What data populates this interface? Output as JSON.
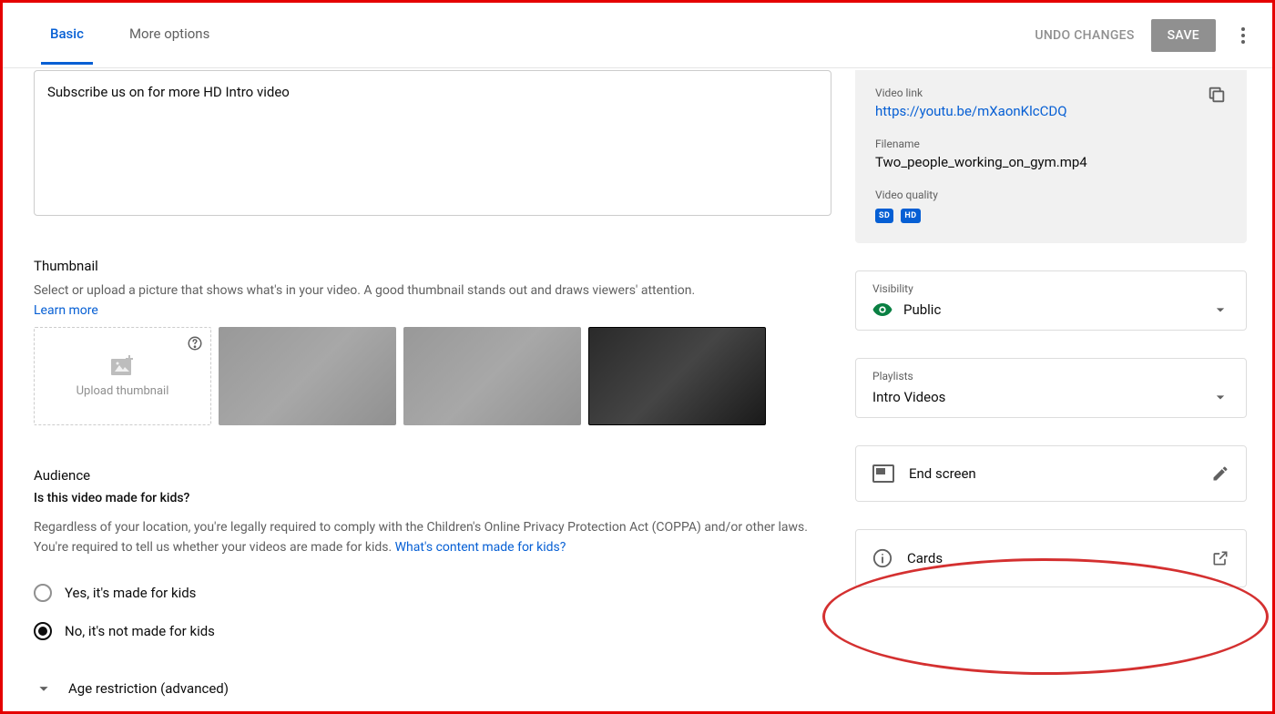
{
  "header": {
    "tabs": {
      "basic": "Basic",
      "more": "More options"
    },
    "undo": "UNDO CHANGES",
    "save": "SAVE"
  },
  "description": "Subscribe us on for more HD Intro video",
  "thumbnail": {
    "title": "Thumbnail",
    "desc": "Select or upload a picture that shows what's in your video. A good thumbnail stands out and draws viewers' attention.",
    "learn": "Learn more",
    "upload": "Upload thumbnail"
  },
  "audience": {
    "title": "Audience",
    "question": "Is this video made for kids?",
    "desc_pre": "Regardless of your location, you're legally required to comply with the Children's Online Privacy Protection Act (COPPA) and/or other laws. You're required to tell us whether your videos are made for kids. ",
    "desc_link": "What's content made for kids?",
    "opt_yes": "Yes, it's made for kids",
    "opt_no": "No, it's not made for kids",
    "age_restrict": "Age restriction (advanced)"
  },
  "side": {
    "video_link_label": "Video link",
    "video_link": "https://youtu.be/mXaonKlcCDQ",
    "filename_label": "Filename",
    "filename": "Two_people_working_on_gym.mp4",
    "quality_label": "Video quality",
    "badge_sd": "SD",
    "badge_hd": "HD",
    "visibility_label": "Visibility",
    "visibility": "Public",
    "playlists_label": "Playlists",
    "playlists": "Intro Videos",
    "end_screen": "End screen",
    "cards": "Cards"
  }
}
